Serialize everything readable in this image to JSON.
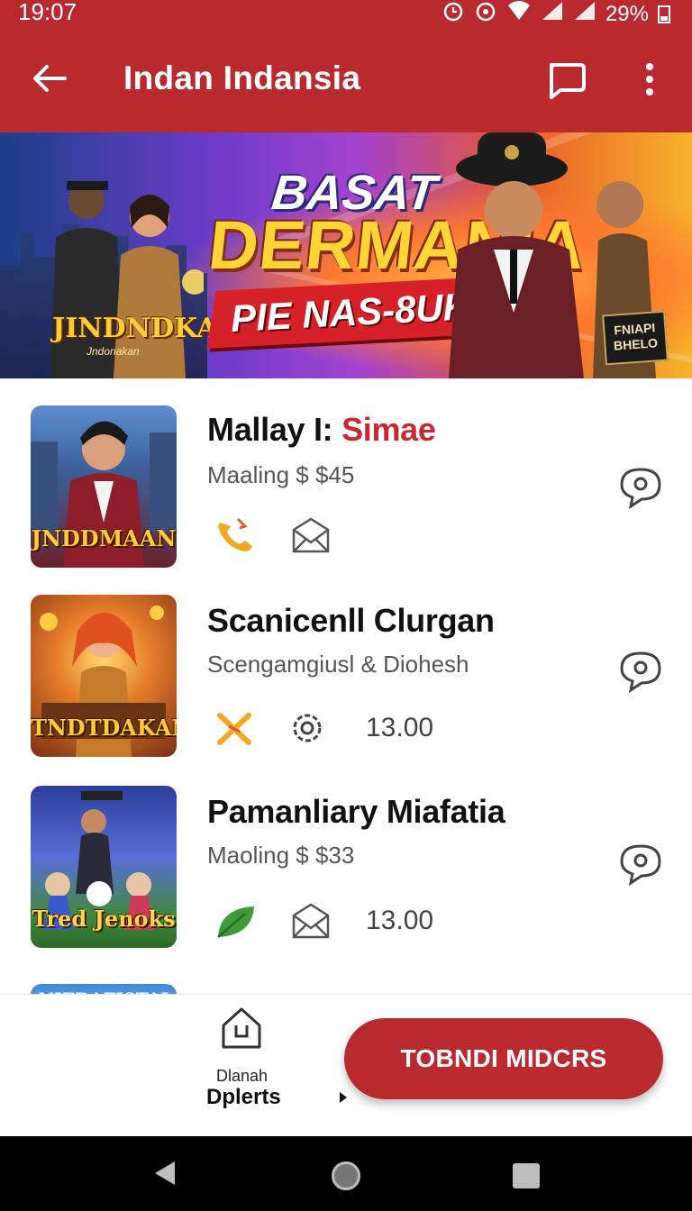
{
  "status_bar": {
    "time": "19:07",
    "battery": "29%"
  },
  "app_bar": {
    "title": "Indan Indansia"
  },
  "banner": {
    "headline_top": "BASAT",
    "headline_main": "DERMANIA",
    "ribbon": "PIE NAS-8UK",
    "logo": "JINDNDKAN",
    "logo_sub": "Jndonakan",
    "badge": "FNIAPI BHELO"
  },
  "items": [
    {
      "title_main": "Mallay I:",
      "title_accent": "Simae",
      "subtitle": "Maaling $ $45",
      "thumb_label": "JNDDMAAN",
      "icons": [
        "phone-icon",
        "mail-icon"
      ],
      "price": ""
    },
    {
      "title_main": "Scanicenll Clurgan",
      "title_accent": "",
      "subtitle": "Scengamgiusl & Diohesh",
      "thumb_label": "TNDTDAKAN",
      "icons": [
        "sparkle-icon",
        "gear-icon"
      ],
      "price": "13.00"
    },
    {
      "title_main": "Pamanliary Miafatia",
      "title_accent": "",
      "subtitle": "Maoling $ $33",
      "thumb_label": "Tred Jenoks",
      "icons": [
        "leaf-icon",
        "mail-icon"
      ],
      "price": "13.00"
    },
    {
      "thumb_label": "NIEDAFISTAI"
    }
  ],
  "bottom_nav": {
    "home_label": "Dlanah",
    "sub_label": "Dplerts",
    "cta_label": "TOBNDI MIDCRS"
  },
  "colors": {
    "brand": "#b92a2e",
    "accent_text": "#c8282e"
  }
}
